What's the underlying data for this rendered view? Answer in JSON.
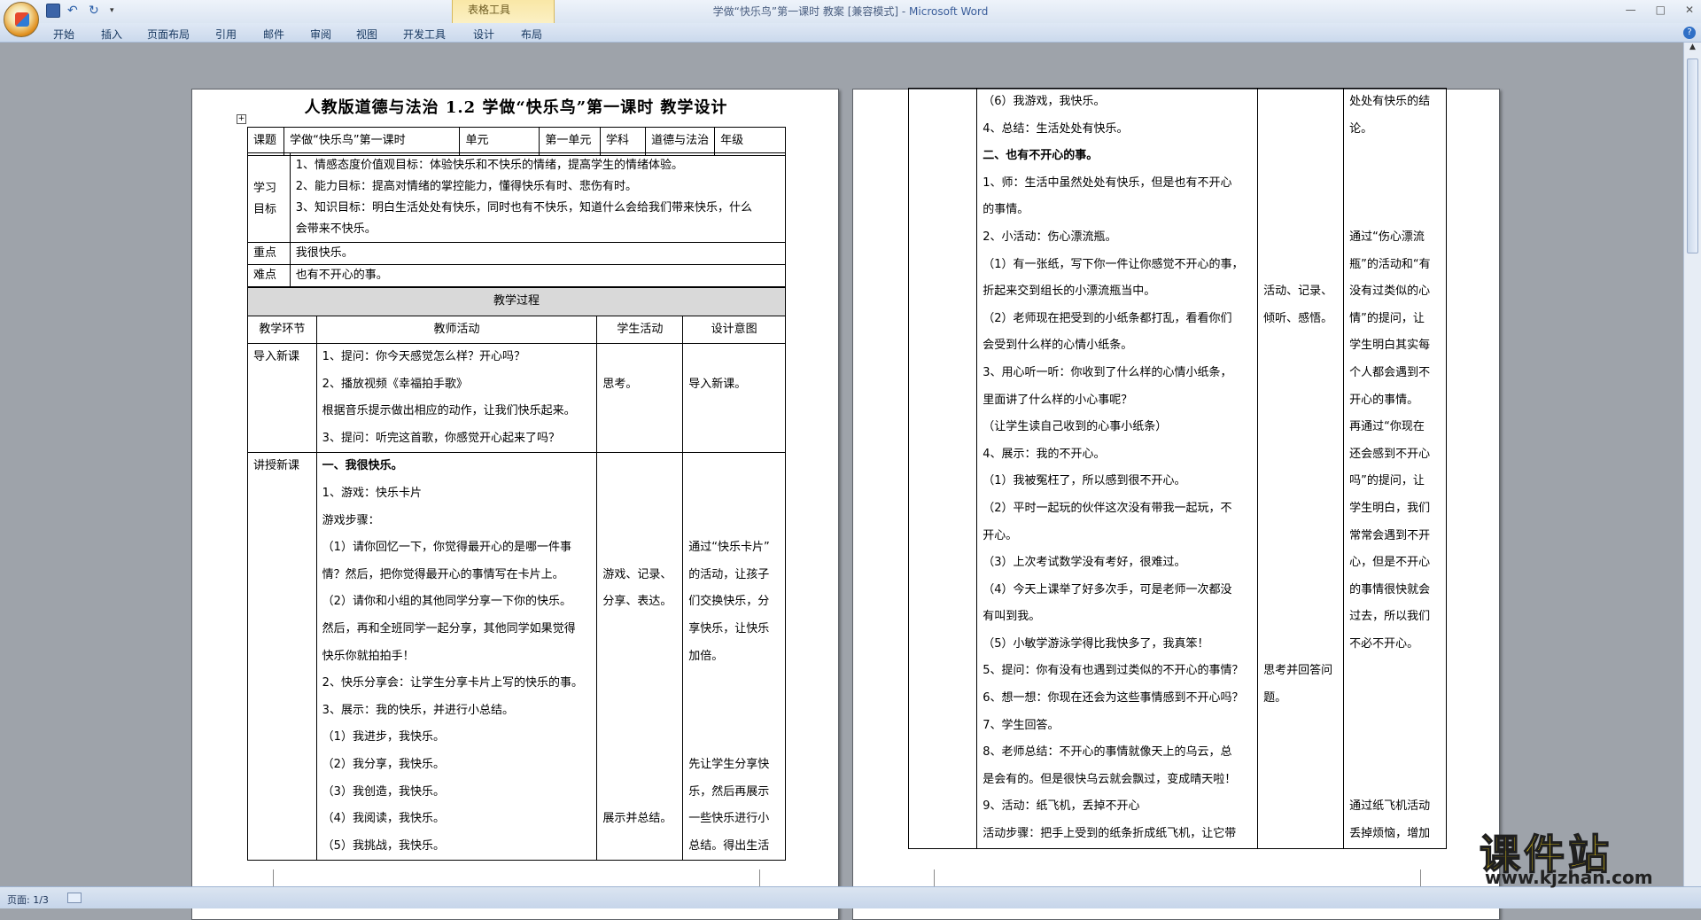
{
  "window": {
    "title": "学做“快乐鸟”第一课时 教案 [兼容模式] - ",
    "app_name": "Microsoft Word",
    "context_group": "表格工具",
    "min": "—",
    "max": "□",
    "close": "✕"
  },
  "ribbon": {
    "tabs": [
      "开始",
      "插入",
      "页面布局",
      "引用",
      "邮件",
      "审阅",
      "视图",
      "开发工具",
      "设计",
      "布局"
    ],
    "help": "?"
  },
  "page1": {
    "title": "人教版道德与法治 1.2  学做“快乐鸟”第一课时   教学设计",
    "header_row": {
      "label_topic": "课题",
      "topic": "学做“快乐鸟”第一课时",
      "label_unit": "单元",
      "unit": "第一单元",
      "label_subject": "学科",
      "subject": "道德与法治",
      "label_grade": "年级",
      "grade": ""
    },
    "goals_label_1": "学习",
    "goals_label_2": "目标",
    "goals": [
      "1、情感态度价值观目标：体验快乐和不快乐的情绪，提高学生的情绪体验。",
      "2、能力目标：提高对情绪的掌控能力，懂得快乐有时、悲伤有时。",
      "3、知识目标：明白生活处处有快乐，同时也有不快乐，知道什么会给我们带来快乐，什么",
      "会带来不快乐。"
    ],
    "key_label": "重点",
    "key": "我很快乐。",
    "difficult_label": "难点",
    "difficult": "也有不开心的事。",
    "process_header": "教学过程",
    "col_headers": [
      "教学环节",
      "教师活动",
      "学生活动",
      "设计意图"
    ],
    "intro": {
      "stage": "导入新课",
      "teacher": [
        "1、提问：你今天感觉怎么样？开心吗？",
        "2、播放视频《幸福拍手歌》",
        "根据音乐提示做出相应的动作，让我们快乐起来。",
        "3、提问：听完这首歌，你感觉开心起来了吗？"
      ],
      "student": [
        "",
        "思考。",
        "",
        ""
      ],
      "intent": [
        "",
        "导入新课。",
        "",
        ""
      ]
    },
    "lecture": {
      "stage": "讲授新课",
      "teacher": [
        "一、我很快乐。",
        "1、游戏：快乐卡片",
        "游戏步骤：",
        "（1）请你回忆一下，你觉得最开心的是哪一件事",
        "情？然后，把你觉得最开心的事情写在卡片上。",
        "（2）请你和小组的其他同学分享一下你的快乐。",
        "然后，再和全班同学一起分享，其他同学如果觉得",
        "快乐你就拍拍手！",
        "2、快乐分享会：让学生分享卡片上写的快乐的事。",
        "3、展示：我的快乐，并进行小总结。",
        "（1）我进步，我快乐。",
        "（2）我分享，我快乐。",
        "（3）我创造，我快乐。",
        "（4）我阅读，我快乐。",
        "（5）我挑战，我快乐。"
      ],
      "student": [
        "",
        "",
        "",
        "",
        "游戏、记录、",
        "分享、表达。",
        "",
        "",
        "",
        "",
        "",
        "",
        "",
        "展示并总结。",
        ""
      ],
      "intent": [
        "",
        "",
        "",
        "通过“快乐卡片”",
        "的活动，让孩子",
        "们交换快乐，分",
        "享快乐，让快乐",
        "加倍。",
        "",
        "",
        "",
        "先让学生分享快",
        "乐，然后再展示",
        "一些快乐进行小",
        "总结。得出生活"
      ]
    }
  },
  "page2": {
    "teacher": [
      "（6）我游戏，我快乐。",
      "4、总结：生活处处有快乐。",
      "二、也有不开心的事。",
      "1、师：生活中虽然处处有快乐，但是也有不开心",
      "的事情。",
      "2、小活动：伤心漂流瓶。",
      "（1）有一张纸，写下你一件让你感觉不开心的事，",
      "折起来交到组长的小漂流瓶当中。",
      "（2）老师现在把受到的小纸条都打乱，看看你们",
      "会受到什么样的心情小纸条。",
      "3、用心听一听：你收到了什么样的心情小纸条，",
      "里面讲了什么样的小心事呢？",
      "（让学生读自己收到的心事小纸条）",
      "4、展示：我的不开心。",
      "（1）我被冤枉了，所以感到很不开心。",
      "（2）平时一起玩的伙伴这次没有带我一起玩，不",
      "开心。",
      "（3）上次考试数学没有考好，很难过。",
      "（4）今天上课举了好多次手，可是老师一次都没",
      "有叫到我。",
      "（5）小敏学游泳学得比我快多了，我真笨！",
      "5、提问：你有没有也遇到过类似的不开心的事情？",
      "6、想一想：你现在还会为这些事情感到不开心吗？",
      "7、学生回答。",
      "8、老师总结：不开心的事情就像天上的乌云，总",
      "是会有的。但是很快乌云就会飘过，变成晴天啦！",
      "9、活动：纸飞机，丢掉不开心",
      "活动步骤：把手上受到的纸条折成纸飞机，让它带"
    ],
    "student": [
      "",
      "",
      "",
      "",
      "",
      "",
      "",
      "活动、记录、",
      "倾听、感悟。",
      "",
      "",
      "",
      "",
      "",
      "",
      "",
      "",
      "",
      "",
      "",
      "",
      "思考并回答问",
      "题。",
      "",
      "",
      "",
      "",
      ""
    ],
    "intent": [
      "处处有快乐的结",
      "论。",
      "",
      "",
      "",
      "通过“伤心漂流",
      "瓶”的活动和“有",
      "没有过类似的心",
      "情”的提问，让",
      "学生明白其实每",
      "个人都会遇到不",
      "开心的事情。",
      "再通过“你现在",
      "还会感到不开心",
      "吗”的提问，让",
      "学生明白，我们",
      "常常会遇到不开",
      "心，但是不开心",
      "的事情很快就会",
      "过去，所以我们",
      "不必不开心。",
      "",
      "",
      "",
      "",
      "",
      "通过纸飞机活动",
      "丢掉烦恼，增加"
    ]
  },
  "status": {
    "page": "页面: 1/3"
  },
  "watermark": {
    "main": "课件站",
    "url": "www.kjzhan.com"
  },
  "colors": {
    "ribbon_bg": "#cbd9ec",
    "doc_bg": "#9ea3aa",
    "context_tab": "#f9e7a6",
    "watermark": "#f2d21a"
  }
}
